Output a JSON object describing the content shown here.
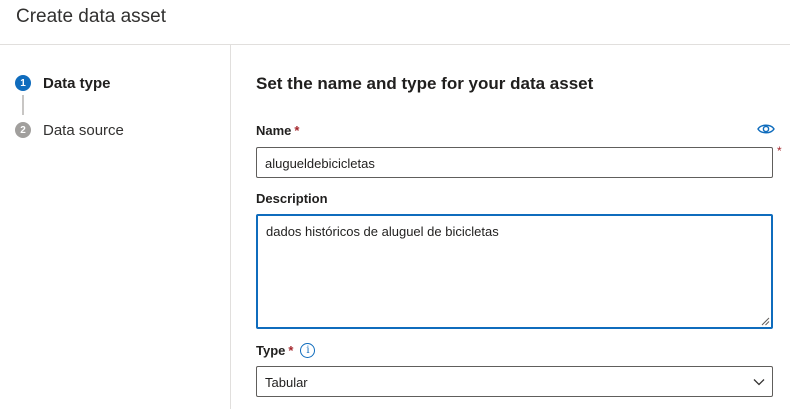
{
  "header": {
    "title": "Create data asset"
  },
  "steps": [
    {
      "number": "1",
      "label": "Data type"
    },
    {
      "number": "2",
      "label": "Data source"
    }
  ],
  "main": {
    "section_title": "Set the name and type for your data asset",
    "name": {
      "label": "Name",
      "required": "*",
      "value": "alugueldebicicletas",
      "side_required": "*"
    },
    "description": {
      "label": "Description",
      "value": "dados históricos de aluguel de bicicletas"
    },
    "type": {
      "label": "Type",
      "required": "*",
      "info": "i",
      "selected": "Tabular"
    }
  },
  "colors": {
    "accent": "#0f6cbd",
    "required": "#a4262c",
    "border": "#605e5c"
  },
  "icons": {
    "eye": "eye-icon",
    "info": "info-icon",
    "chevron": "chevron-down-icon",
    "resize": "resize-handle-icon"
  }
}
